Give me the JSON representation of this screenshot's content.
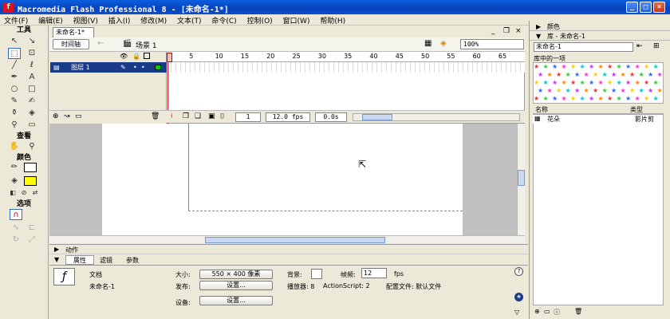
{
  "window": {
    "title": "Macromedia Flash Professional 8 - [未命名-1*]",
    "min": "_",
    "max": "□",
    "close": "×"
  },
  "menu": [
    "文件(F)",
    "编辑(E)",
    "视图(V)",
    "插入(I)",
    "修改(M)",
    "文本(T)",
    "命令(C)",
    "控制(O)",
    "窗口(W)",
    "帮助(H)"
  ],
  "tools": {
    "header": "工具",
    "view_header": "查看",
    "color_header": "颜色",
    "options_header": "选项"
  },
  "document": {
    "tab": "未命名-1*",
    "timeline_button": "时间轴",
    "scene": "场景 1",
    "zoom": "100%"
  },
  "timeline": {
    "frame_numbers": [
      "1",
      "5",
      "10",
      "15",
      "20",
      "25",
      "30",
      "35",
      "40",
      "45",
      "50",
      "55",
      "60",
      "65"
    ],
    "layer_name": "图层 1",
    "current_frame": "1",
    "fps": "12.0 fps",
    "elapsed": "0.0s"
  },
  "panels": {
    "actions": "动作",
    "tabs": [
      "属性",
      "滤镜",
      "参数"
    ]
  },
  "properties": {
    "doc_type": "文档",
    "doc_name": "未命名-1",
    "size_label": "大小:",
    "size_value": "550 × 400 像素",
    "background_label": "背景:",
    "framerate_label": "帧频:",
    "framerate_value": "12",
    "fps_unit": "fps",
    "publish_label": "发布:",
    "settings_button": "设置...",
    "player_info": "播放器: 8",
    "actionscript_info": "ActionScript: 2",
    "profile_info": "配置文件: 默认文件",
    "device_label": "设备:",
    "device_button": "设置..."
  },
  "right_panel": {
    "color_title": "颜色",
    "library_title": "库 - 未命名-1",
    "library_dropdown": "未命名-1",
    "one_item": "库中的一项",
    "col_name": "名称",
    "col_type": "类型",
    "item_name": "花朵",
    "item_type": "影片剪"
  },
  "colors": {
    "title_bar": "#0a4fd0",
    "selection": "#1a3a8a",
    "playhead": "#cc0000",
    "panel_bg": "#ece9d8"
  }
}
